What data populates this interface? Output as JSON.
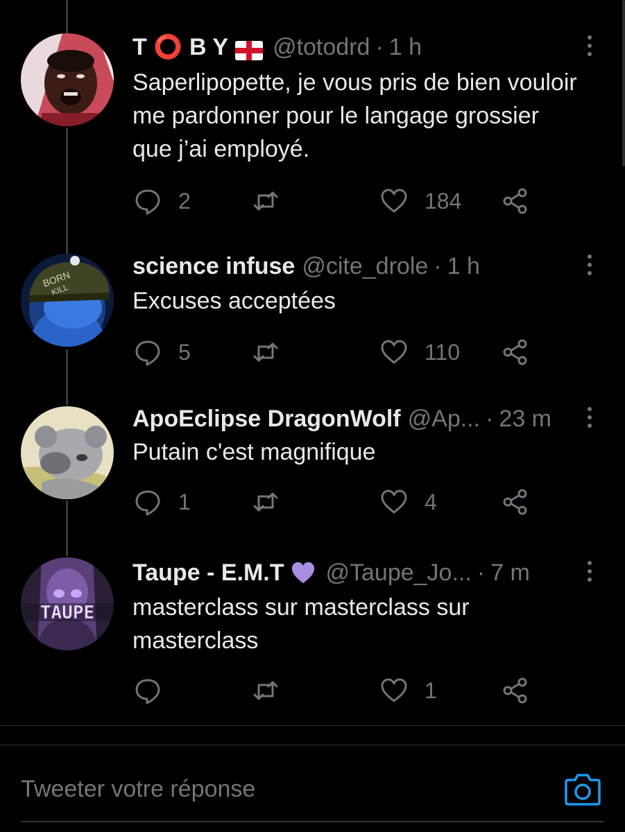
{
  "tweets": [
    {
      "display_name": "T ⭕ B Y",
      "handle": "@totodrd",
      "time": "1 h",
      "text": "Saperlipopette, je vous pris de bien vouloir me pardonner pour le langage grossier que j’ai employé.",
      "replies": "2",
      "retweets": "",
      "likes": "184"
    },
    {
      "display_name": "science infuse",
      "handle": "@cite_drole",
      "time": "1 h",
      "text": "Excuses acceptées",
      "replies": "5",
      "retweets": "",
      "likes": "110"
    },
    {
      "display_name": "ApoEclipse DragonWolf",
      "handle": "@Ap...",
      "time": "23 m",
      "text": "Putain c'est magnifique",
      "replies": "1",
      "retweets": "",
      "likes": "4"
    },
    {
      "display_name": "Taupe - E.M.T",
      "handle": "@Taupe_Jo...",
      "time": "7 m",
      "text": "masterclass sur masterclass sur masterclass",
      "replies": "",
      "retweets": "",
      "likes": "1",
      "avatar_text": "TAUPE"
    }
  ],
  "separator": "·",
  "reply_placeholder": "Tweeter votre réponse",
  "icons": {
    "reply": "speech-bubble-icon",
    "retweet": "retweet-arrows-icon",
    "like": "heart-icon",
    "share": "share-nodes-icon",
    "more": "vertical-dots-icon",
    "camera": "camera-icon"
  },
  "colors": {
    "background": "#000000",
    "text": "#e7e9ea",
    "muted": "#71767b",
    "accent": "#1d9bf0",
    "heart_emoji": "#a98de0"
  }
}
